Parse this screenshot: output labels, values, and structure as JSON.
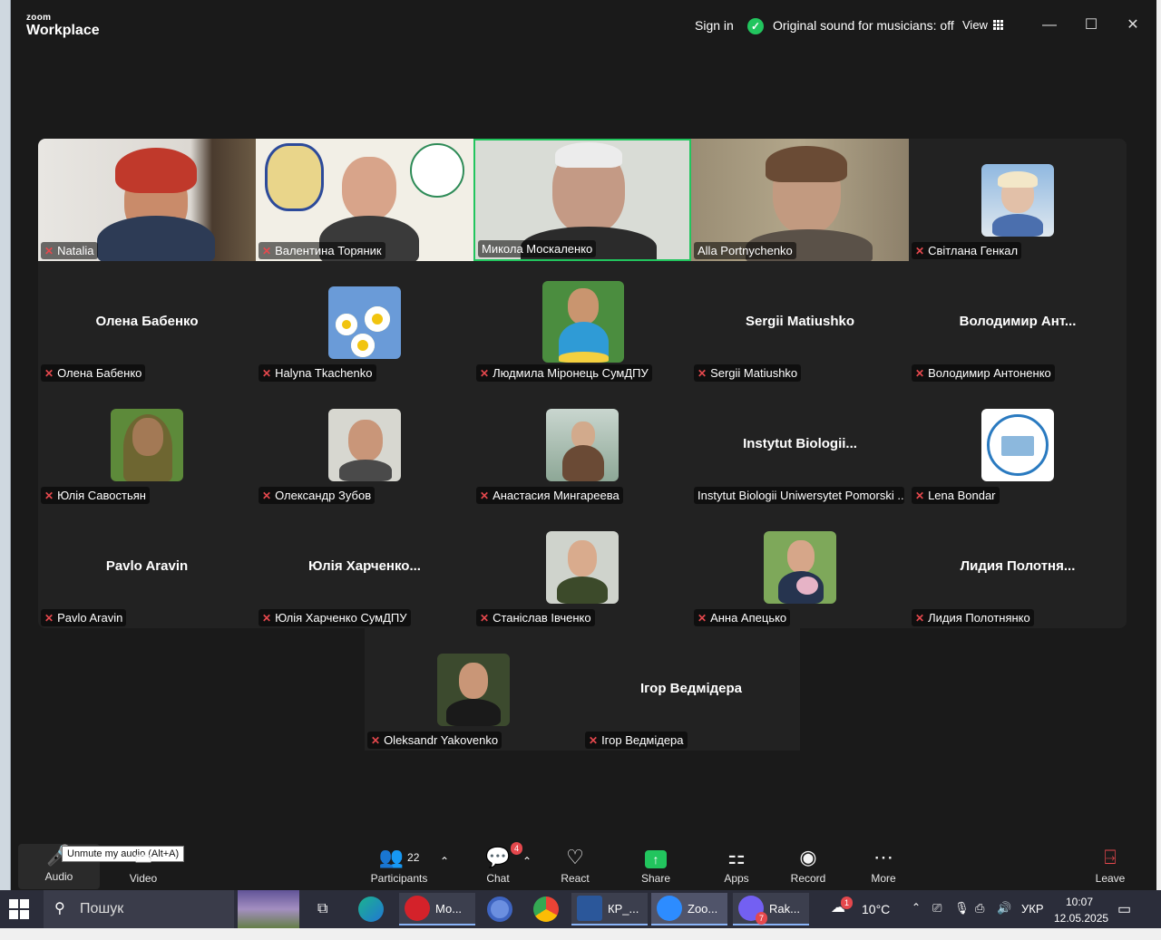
{
  "titlebar": {
    "logo_top": "zoom",
    "logo_bottom": "Workplace",
    "sign_in": "Sign in",
    "original_sound": "Original sound for musicians: off",
    "view": "View",
    "minimize": "—",
    "maximize": "☐",
    "close": "✕"
  },
  "participants": [
    {
      "name": "Natalia",
      "kind": "video",
      "muted": true
    },
    {
      "name": "Валентина Торяник",
      "kind": "video",
      "muted": true
    },
    {
      "name": "Микола Москаленко",
      "kind": "video",
      "muted": false,
      "active": true
    },
    {
      "name": "Alla Portnychenko",
      "kind": "video",
      "muted": false
    },
    {
      "name": "Світлана Генкал",
      "kind": "avatar",
      "muted": true
    },
    {
      "name": "Олена Бабенко",
      "display": "Олена Бабенко",
      "kind": "name",
      "muted": true
    },
    {
      "name": "Halyna Tkachenko",
      "kind": "avatar",
      "muted": true
    },
    {
      "name": "Людмила Міронець СумДПУ",
      "kind": "avatar",
      "muted": true
    },
    {
      "name": "Sergii Matiushko",
      "display": "Sergii Matiushko",
      "kind": "name",
      "muted": true
    },
    {
      "name": "Володимир Антоненко",
      "display": "Володимир Ант...",
      "kind": "name",
      "muted": true
    },
    {
      "name": "Юлія Савостьян",
      "kind": "avatar",
      "muted": true
    },
    {
      "name": "Олександр Зубов",
      "kind": "avatar",
      "muted": true
    },
    {
      "name": "Анастасия Мингареева",
      "kind": "avatar",
      "muted": true
    },
    {
      "name": "Instytut Biologii Uniwersytet Pomorski ...",
      "display": "Instytut Biologii...",
      "kind": "name",
      "muted": false
    },
    {
      "name": "Lena Bondar",
      "kind": "avatar",
      "muted": true
    },
    {
      "name": "Pavlo Aravin",
      "display": "Pavlo Aravin",
      "kind": "name",
      "muted": true
    },
    {
      "name": "Юлія Харченко СумДПУ",
      "display": "Юлія Харченко...",
      "kind": "name",
      "muted": true
    },
    {
      "name": "Станіслав Івченко",
      "kind": "avatar",
      "muted": true
    },
    {
      "name": "Анна Апецько",
      "kind": "avatar",
      "muted": true
    },
    {
      "name": "Лидия Полотнянко",
      "display": "Лидия Полотня...",
      "kind": "name",
      "muted": true
    },
    {
      "name": "Oleksandr Yakovenko",
      "kind": "avatar",
      "muted": true
    },
    {
      "name": "Ігор Ведмідера",
      "display": "Ігор Ведмідера",
      "kind": "name",
      "muted": true
    }
  ],
  "toolbar": {
    "audio": "Audio",
    "tooltip": "Unmute my audio (Alt+A)",
    "video": "Video",
    "participants": "Participants",
    "participants_count": "22",
    "chat": "Chat",
    "chat_badge": "4",
    "react": "React",
    "share": "Share",
    "apps": "Apps",
    "record": "Record",
    "more": "More",
    "leave": "Leave"
  },
  "taskbar": {
    "search": "Пошук",
    "app1": "Мо...",
    "app2": "КР_...",
    "app3": "Zoo...",
    "app4": "Rak...",
    "viber_badge": "7",
    "weather_badge": "1",
    "temp": "10°C",
    "lang": "УКР",
    "time": "10:07",
    "date": "12.05.2025"
  },
  "colors": {
    "accent_green": "#22c55e",
    "mute_red": "#e5484d",
    "app_bg": "#1a1a1a",
    "tile_bg": "#222222"
  }
}
